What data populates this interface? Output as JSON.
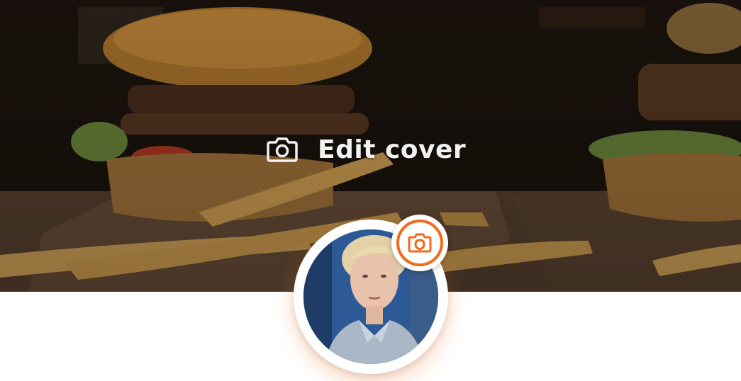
{
  "cover": {
    "edit_label": "Edit cover",
    "icon": "camera-icon",
    "image": "burger-and-fries-photo"
  },
  "profile": {
    "avatar_image": "woman-portrait-photo",
    "avatar_icon": "camera-icon",
    "accent_color": "#f26a1b"
  }
}
